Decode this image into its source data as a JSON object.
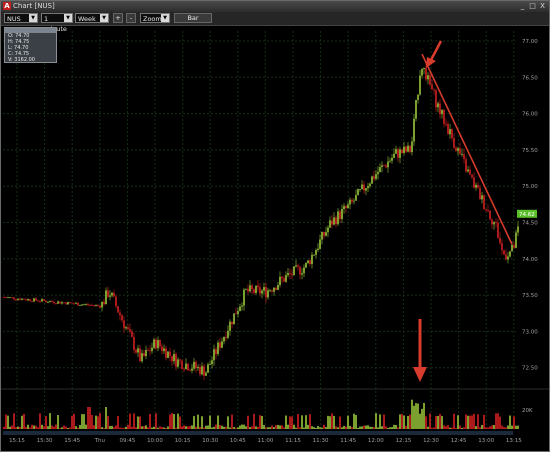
{
  "window": {
    "title": "Chart [NUS]",
    "logo_letter": "A",
    "buttons": [
      "_",
      "□",
      "X"
    ]
  },
  "toolbar": {
    "symbol": "NUS",
    "interval": "1 minute",
    "range": "Week",
    "plus_label": "+",
    "minus_label": "-",
    "zoom_label": "Zoom",
    "bar_label": "Bar"
  },
  "info_box": {
    "header": "",
    "lines": [
      "O: 74.70",
      "H: 74.75",
      "L: 74.70",
      "C: 74.75",
      "V: 3162.00"
    ]
  },
  "colors": {
    "up": "#9ac83c",
    "down": "#d42020",
    "grid": "#152f16",
    "axis_text": "#a0a0a0",
    "last_price_bg": "#5bbf2a",
    "annotation": "#d83c2c"
  },
  "chart_data": {
    "type": "candlestick",
    "price_axis_labels": [
      "77.00",
      "76.50",
      "76.00",
      "75.50",
      "75.00",
      "74.50",
      "74.00",
      "73.50",
      "73.00",
      "72.50"
    ],
    "volume_axis_labels": [
      "20K"
    ],
    "last_price": "74.62",
    "time_axis_labels": [
      "15:15",
      "15:30",
      "15:45",
      "Thu",
      "09:45",
      "10:00",
      "10:15",
      "10:30",
      "10:45",
      "11:00",
      "11:15",
      "11:30",
      "11:45",
      "12:00",
      "12:15",
      "12:30",
      "12:45",
      "13:00",
      "13:15"
    ],
    "annotations": [
      "arrow-at-price-peak",
      "arrow-at-volume-spike",
      "downtrend-line"
    ]
  }
}
